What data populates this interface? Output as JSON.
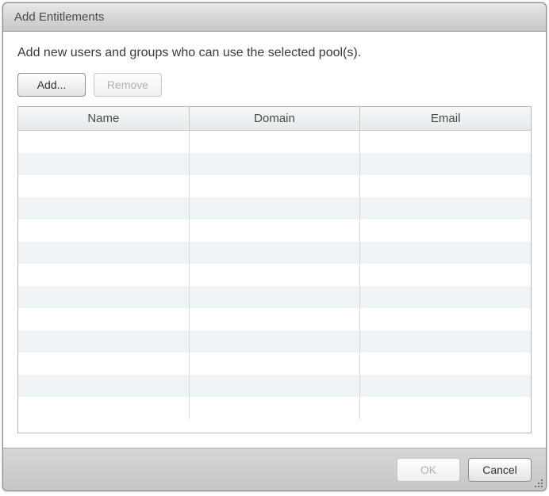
{
  "dialog": {
    "title": "Add Entitlements",
    "instruction": "Add new users and groups who can use the selected pool(s).",
    "buttons": {
      "add_label": "Add...",
      "remove_label": "Remove",
      "remove_enabled": false,
      "ok_label": "OK",
      "ok_enabled": false,
      "cancel_label": "Cancel"
    },
    "table": {
      "columns": [
        "Name",
        "Domain",
        "Email"
      ],
      "rows": [
        {
          "name": "",
          "domain": "",
          "email": ""
        },
        {
          "name": "",
          "domain": "",
          "email": ""
        },
        {
          "name": "",
          "domain": "",
          "email": ""
        },
        {
          "name": "",
          "domain": "",
          "email": ""
        },
        {
          "name": "",
          "domain": "",
          "email": ""
        },
        {
          "name": "",
          "domain": "",
          "email": ""
        },
        {
          "name": "",
          "domain": "",
          "email": ""
        },
        {
          "name": "",
          "domain": "",
          "email": ""
        },
        {
          "name": "",
          "domain": "",
          "email": ""
        },
        {
          "name": "",
          "domain": "",
          "email": ""
        },
        {
          "name": "",
          "domain": "",
          "email": ""
        },
        {
          "name": "",
          "domain": "",
          "email": ""
        },
        {
          "name": "",
          "domain": "",
          "email": ""
        }
      ]
    }
  }
}
